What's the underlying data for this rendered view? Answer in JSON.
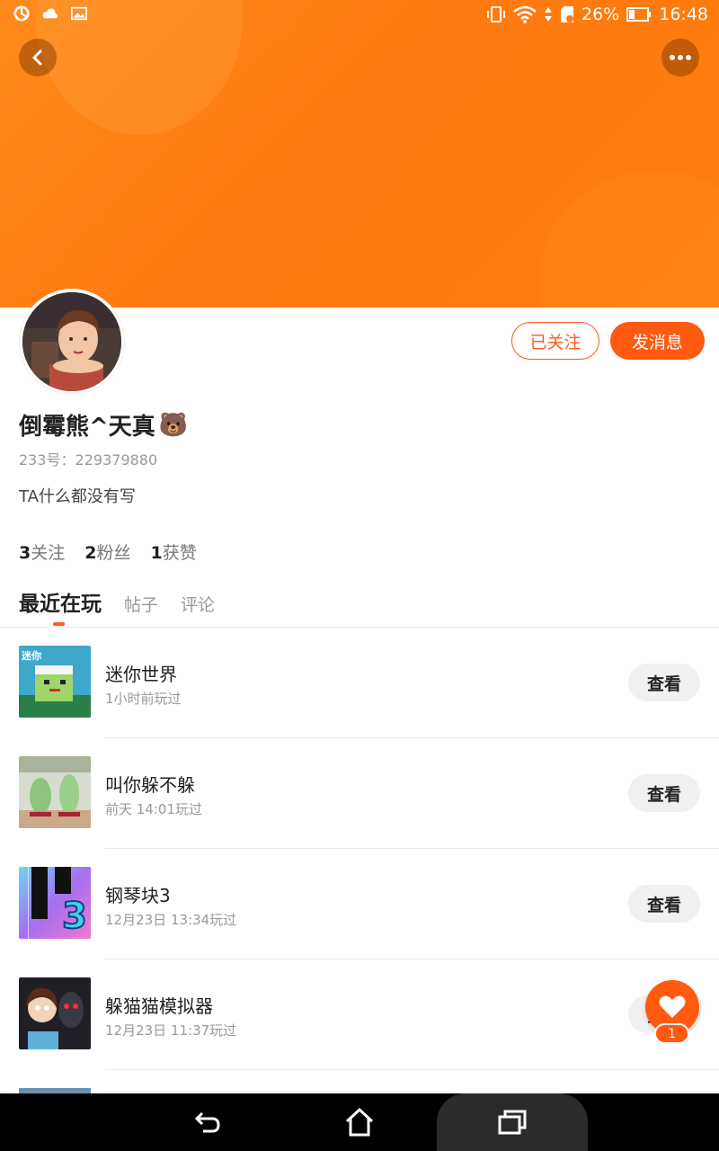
{
  "status_bar": {
    "battery_percent": "26%",
    "time": "16:48",
    "icons_left": [
      "sync-icon",
      "cloud-icon",
      "image-icon"
    ],
    "icons_right": [
      "vibrate-icon",
      "wifi-icon",
      "sim-icon",
      "battery-icon"
    ]
  },
  "header": {
    "back_icon": "back-arrow-icon",
    "more_icon": "more-dots-icon"
  },
  "profile": {
    "username": "倒霉熊^天真",
    "username_emoji": "🐻",
    "uid": "233号：229379880",
    "bio": "TA什么都没有写",
    "follow_button_label": "已关注",
    "message_button_label": "发消息",
    "stats": [
      {
        "count": "3",
        "label": "关注"
      },
      {
        "count": "2",
        "label": "粉丝"
      },
      {
        "count": "1",
        "label": "获赞"
      }
    ]
  },
  "tabs": [
    {
      "label": "最近在玩",
      "active": true
    },
    {
      "label": "帖子",
      "active": false
    },
    {
      "label": "评论",
      "active": false
    }
  ],
  "games": [
    {
      "title": "迷你世界",
      "time": "1小时前玩过",
      "button": "查看",
      "thumb_text": "迷你"
    },
    {
      "title": "叫你躲不躲",
      "time": "前天 14:01玩过",
      "button": "查看"
    },
    {
      "title": "钢琴块3",
      "time": "12月23日 13:34玩过",
      "button": "查看",
      "thumb_text": "3"
    },
    {
      "title": "躲猫猫模拟器",
      "time": "12月23日 11:37玩过",
      "button": "查看"
    }
  ],
  "fab": {
    "icon": "heart-icon",
    "badge": "1"
  },
  "nav": {
    "icons": [
      "nav-back-icon",
      "nav-home-icon",
      "nav-recent-icon"
    ]
  },
  "colors": {
    "accent": "#ff5a10",
    "banner": "#ff8a1a"
  }
}
